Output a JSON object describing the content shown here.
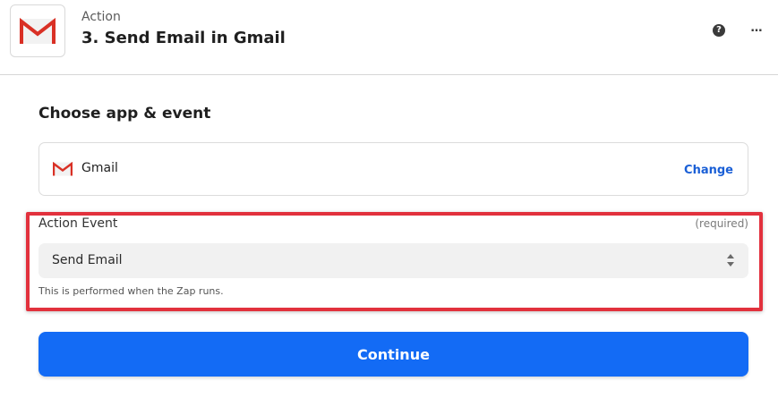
{
  "header": {
    "kicker": "Action",
    "title": "3. Send Email in Gmail",
    "help_icon": "help-circle-icon",
    "help_glyph": "?",
    "more_icon": "more-horizontal-icon",
    "more_glyph": "…"
  },
  "section": {
    "title": "Choose app & event"
  },
  "app": {
    "icon": "gmail-logo-icon",
    "name": "Gmail",
    "change_label": "Change"
  },
  "action_event": {
    "label": "Action Event",
    "required_text": "(required)",
    "value": "Send Email",
    "help_text": "This is performed when the Zap runs."
  },
  "continue_label": "Continue",
  "colors": {
    "accent": "#136bf5",
    "link": "#1a5fd6",
    "highlight_border": "#e2313d",
    "gmail_red": "#d93025"
  }
}
